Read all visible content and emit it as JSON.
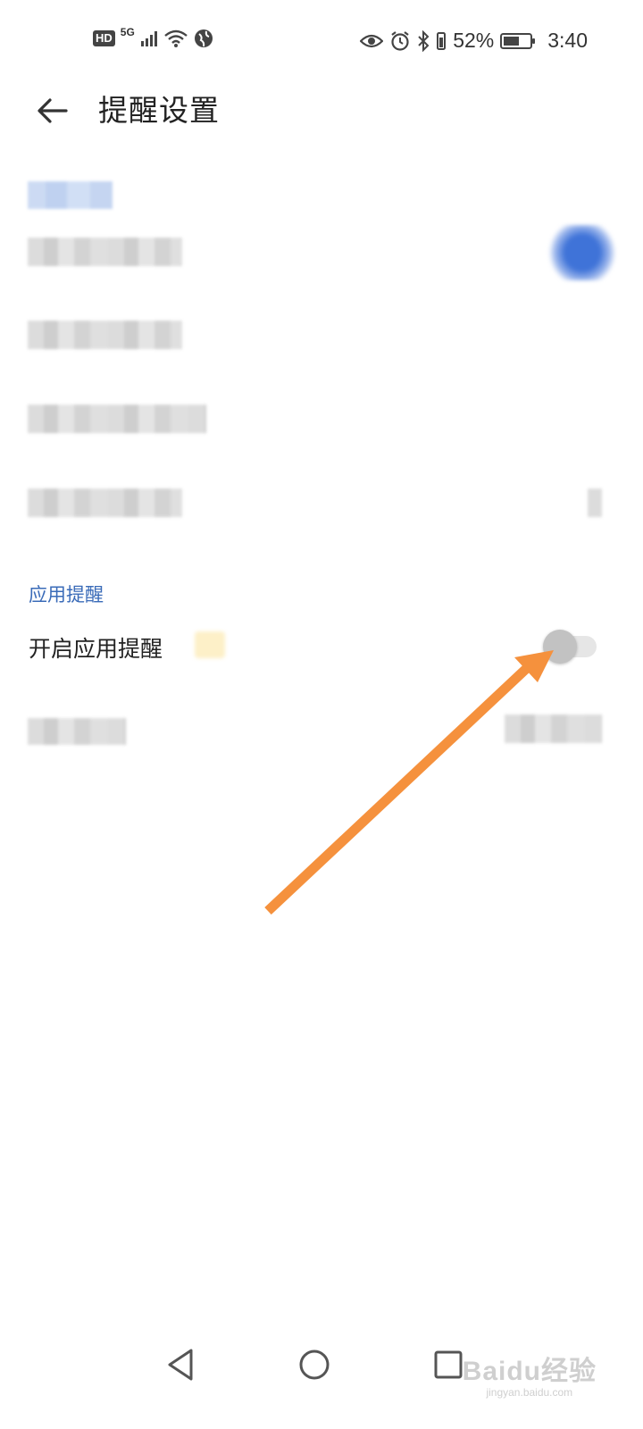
{
  "status_bar": {
    "hd": "HD",
    "network": "5G",
    "battery_percent": "52%",
    "time": "3:40",
    "battery_level": 0.52,
    "icons": [
      "signal-icon",
      "wifi-icon",
      "globe-icon",
      "eye-icon",
      "alarm-icon",
      "bluetooth-icon",
      "vibrate-icon",
      "battery-icon"
    ]
  },
  "header": {
    "title": "提醒设置"
  },
  "section": {
    "header": "应用提醒",
    "toggle_row_label": "开启应用提醒",
    "toggle_on": false
  },
  "watermark": {
    "main": "Baidu经验",
    "sub": "jingyan.baidu.com"
  },
  "colors": {
    "accent": "#3a6bb8",
    "annotation_arrow": "#f5913d",
    "toggle_knob_off": "#c2c2c2"
  }
}
